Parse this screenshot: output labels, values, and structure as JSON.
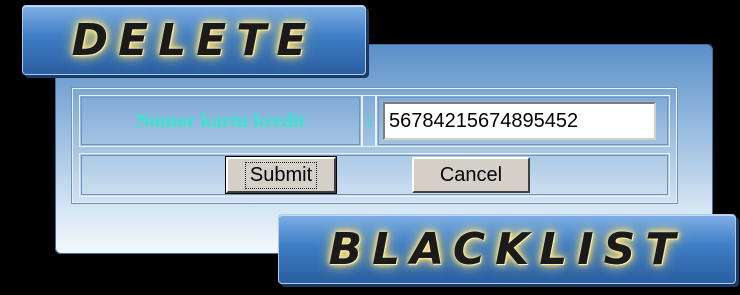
{
  "titles": {
    "top": "DELETE",
    "bottom": "BLACKLIST"
  },
  "form": {
    "card_label": "Nomor kartu kredit",
    "separator": ":",
    "card_value": "56784215674895452",
    "submit_label": "Submit",
    "cancel_label": "Cancel"
  },
  "colors": {
    "background": "#000000",
    "label": "#38e6d0",
    "panel_top": "#5b8fc7",
    "panel_bottom": "#f4f8fc",
    "button_face": "#d4d0c8"
  }
}
